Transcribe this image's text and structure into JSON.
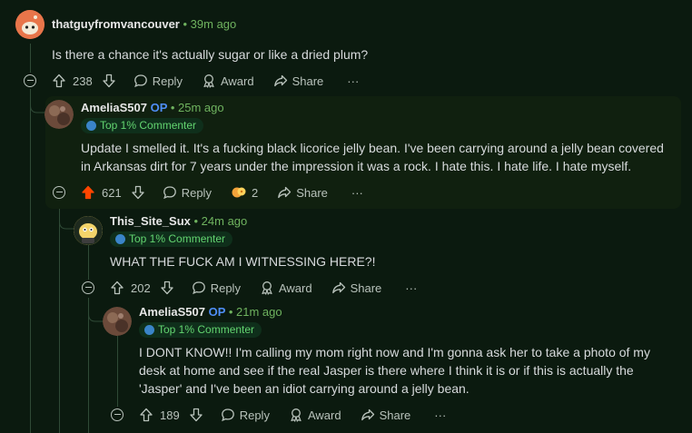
{
  "comments": [
    {
      "username": "thatguyfromvancouver",
      "time": "39m ago",
      "body": "Is there a chance it's actually sugar or like a dried plum?",
      "votes": "238",
      "reply": "Reply",
      "award": "Award",
      "share": "Share",
      "more": "···"
    },
    {
      "username": "AmeliaS507",
      "op": "OP",
      "time": "25m ago",
      "badge": "Top 1% Commenter",
      "body": "Update I smelled it. It's a fucking black licorice jelly bean. I've been carrying around a jelly bean covered in Arkansas dirt for 7 years under the impression it was a rock. I hate this. I hate life. I hate myself.",
      "votes": "621",
      "reply": "Reply",
      "awards": "2",
      "share": "Share",
      "more": "···"
    },
    {
      "username": "This_Site_Sux",
      "time": "24m ago",
      "badge": "Top 1% Commenter",
      "body": "WHAT THE FUCK AM I WITNESSING HERE?!",
      "votes": "202",
      "reply": "Reply",
      "award": "Award",
      "share": "Share",
      "more": "···"
    },
    {
      "username": "AmeliaS507",
      "op": "OP",
      "time": "21m ago",
      "badge": "Top 1% Commenter",
      "body": "I DONT KNOW!! I'm calling my mom right now and I'm gonna ask her to take a photo of my desk at home and see if the real Jasper is there where I think it is or if this is actually the 'Jasper' and I've been an idiot carrying around a jelly bean.",
      "votes": "189",
      "reply": "Reply",
      "award": "Award",
      "share": "Share",
      "more": "···"
    }
  ],
  "colors": {
    "background": "#0b1a0f",
    "upvoted": "#ff4500",
    "op": "#4f8ef7",
    "badge_text": "#63d470",
    "time": "#6fb35f"
  }
}
